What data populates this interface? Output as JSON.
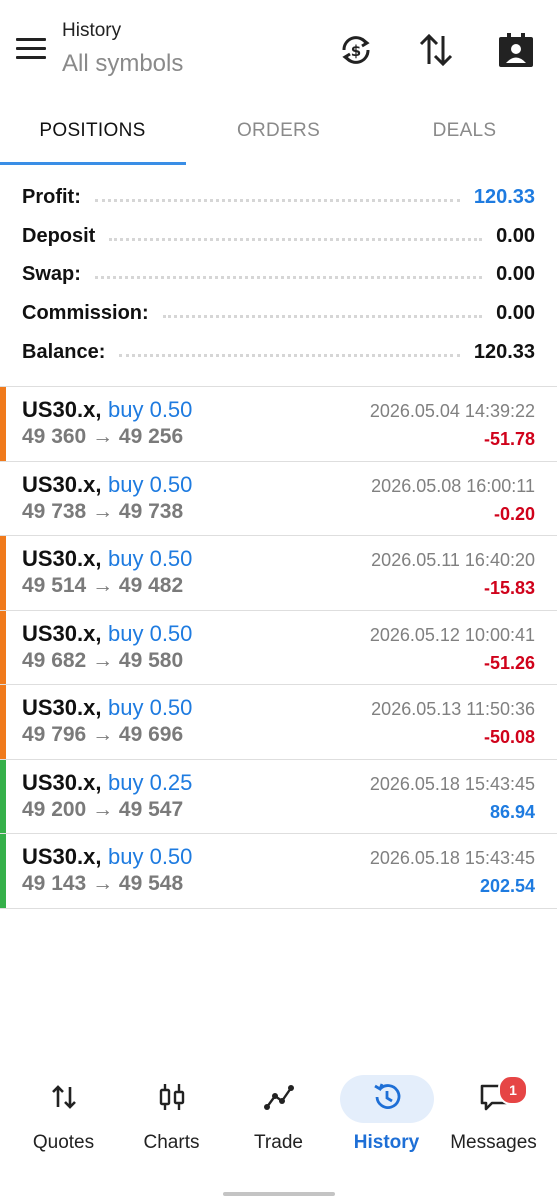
{
  "header": {
    "title": "History",
    "subtitle": "All symbols",
    "icons": [
      "menu-icon",
      "currency-exchange-icon",
      "sort-arrows-icon",
      "account-card-icon"
    ]
  },
  "tabs": [
    {
      "label": "POSITIONS",
      "active": true
    },
    {
      "label": "ORDERS",
      "active": false
    },
    {
      "label": "DEALS",
      "active": false
    }
  ],
  "summary": [
    {
      "label": "Profit:",
      "value": "120.33",
      "highlight": true
    },
    {
      "label": "Deposit",
      "value": "0.00",
      "highlight": false
    },
    {
      "label": "Swap:",
      "value": "0.00",
      "highlight": false
    },
    {
      "label": "Commission:",
      "value": "0.00",
      "highlight": false
    },
    {
      "label": "Balance:",
      "value": "120.33",
      "highlight": false
    }
  ],
  "positions": [
    {
      "symbol": "US30.x,",
      "direction": "buy 0.50",
      "prices": "49 360 → 49 256",
      "datetime": "2026.05.04 14:39:22",
      "pl": "-51.78",
      "status": "loss"
    },
    {
      "symbol": "US30.x,",
      "direction": "buy 0.50",
      "prices": "49 738 → 49 738",
      "datetime": "2026.05.08 16:00:11",
      "pl": "-0.20",
      "status": "none"
    },
    {
      "symbol": "US30.x,",
      "direction": "buy 0.50",
      "prices": "49 514 → 49 482",
      "datetime": "2026.05.11 16:40:20",
      "pl": "-15.83",
      "status": "loss"
    },
    {
      "symbol": "US30.x,",
      "direction": "buy 0.50",
      "prices": "49 682 → 49 580",
      "datetime": "2026.05.12 10:00:41",
      "pl": "-51.26",
      "status": "loss"
    },
    {
      "symbol": "US30.x,",
      "direction": "buy 0.50",
      "prices": "49 796 → 49 696",
      "datetime": "2026.05.13 11:50:36",
      "pl": "-50.08",
      "status": "loss"
    },
    {
      "symbol": "US30.x,",
      "direction": "buy 0.25",
      "prices": "49 200 → 49 547",
      "datetime": "2026.05.18 15:43:45",
      "pl": "86.94",
      "status": "profit"
    },
    {
      "symbol": "US30.x,",
      "direction": "buy 0.50",
      "prices": "49 143 → 49 548",
      "datetime": "2026.05.18 15:43:45",
      "pl": "202.54",
      "status": "profit"
    }
  ],
  "colors": {
    "loss_bar": "#f07a1c",
    "profit_bar": "#35b04a",
    "loss_text": "#d0021b",
    "profit_text": "#1e7be0",
    "accent": "#3a8ee6"
  },
  "bottom_nav": [
    {
      "label": "Quotes",
      "icon": "quotes-arrows-icon",
      "active": false
    },
    {
      "label": "Charts",
      "icon": "candlestick-icon",
      "active": false
    },
    {
      "label": "Trade",
      "icon": "trade-line-icon",
      "active": false
    },
    {
      "label": "History",
      "icon": "history-clock-icon",
      "active": true
    },
    {
      "label": "Messages",
      "icon": "messages-icon",
      "active": false,
      "badge": "1"
    }
  ]
}
